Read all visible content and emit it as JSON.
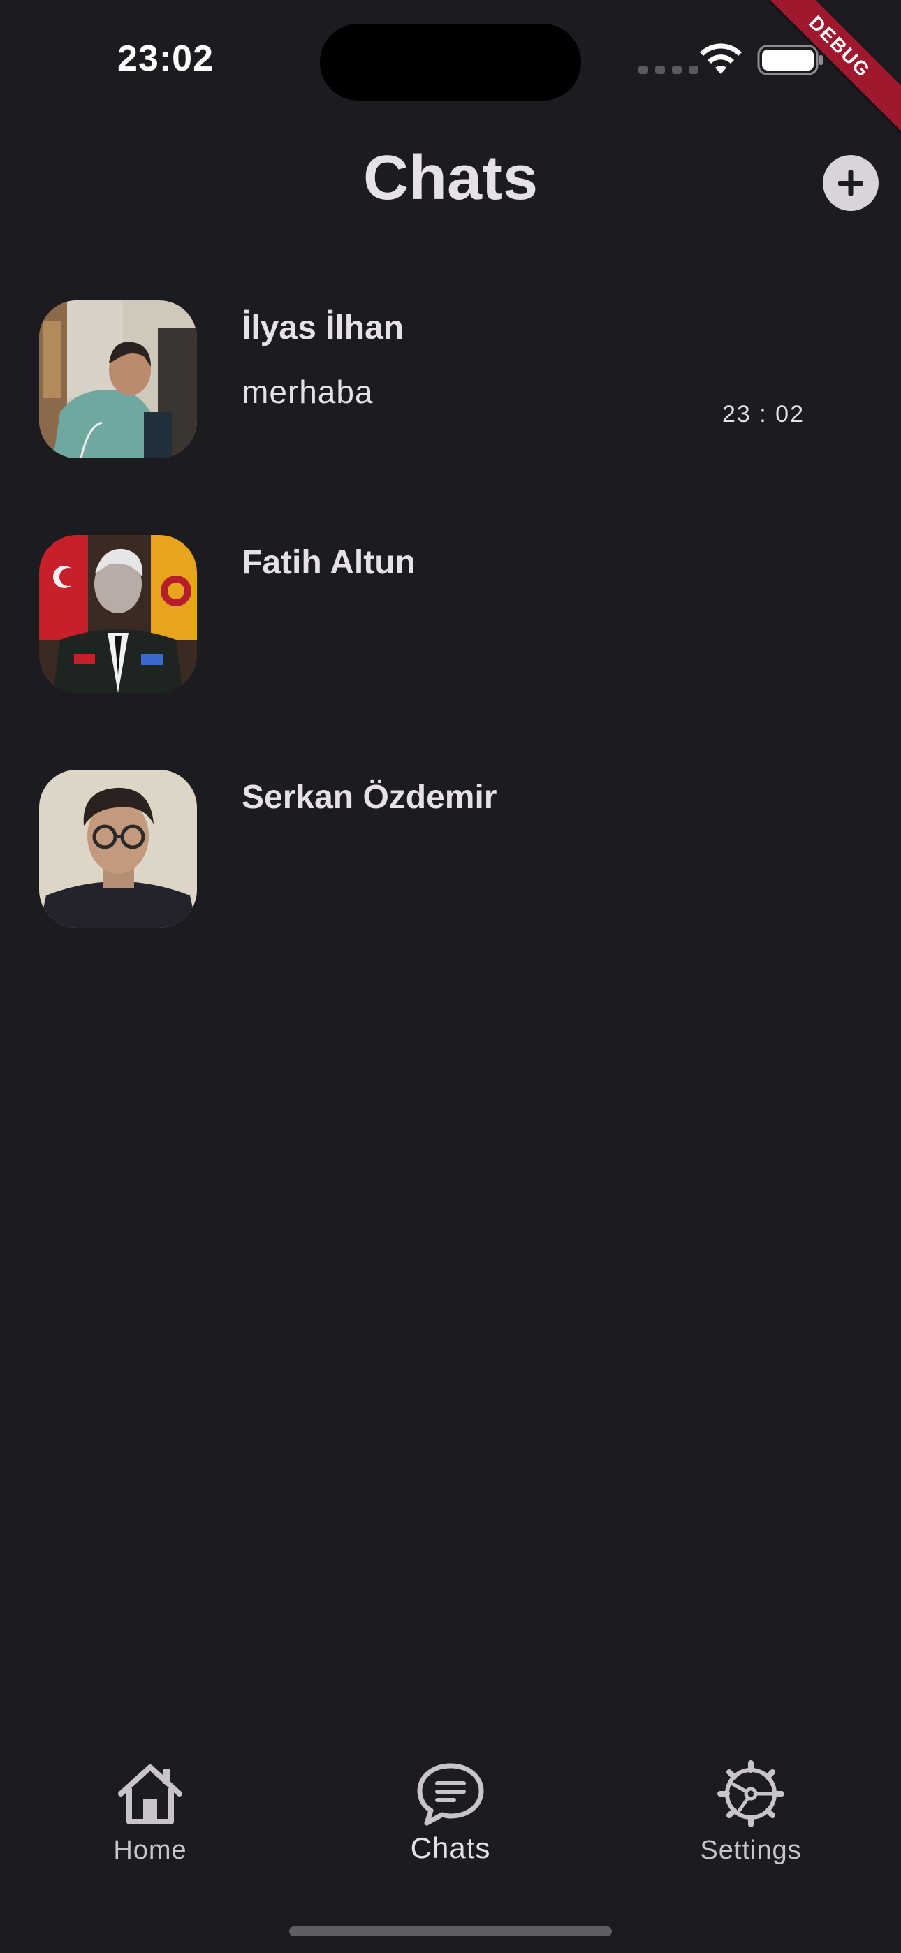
{
  "status_bar": {
    "time": "23:02"
  },
  "debug_banner": "DEBUG",
  "header": {
    "title": "Chats",
    "add_icon": "plus-icon"
  },
  "chats": [
    {
      "name": "İlyas İlhan",
      "message": "merhaba",
      "time": "23 : 02",
      "avatar": "avatar-photo"
    },
    {
      "name": "Fatih Altun",
      "message": "",
      "time": "",
      "avatar": "avatar-photo"
    },
    {
      "name": "Serkan Özdemir",
      "message": "",
      "time": "",
      "avatar": "avatar-photo"
    }
  ],
  "bottom_nav": {
    "items": [
      {
        "label": "Home",
        "icon": "home-icon",
        "active": false
      },
      {
        "label": "Chats",
        "icon": "chat-bubble-icon",
        "active": true
      },
      {
        "label": "Settings",
        "icon": "gear-icon",
        "active": false
      }
    ]
  },
  "colors": {
    "background": "#1c1b20",
    "text": "#e6e1e8",
    "add_button": "#d9d3dc",
    "debug_banner": "#a0182d"
  }
}
